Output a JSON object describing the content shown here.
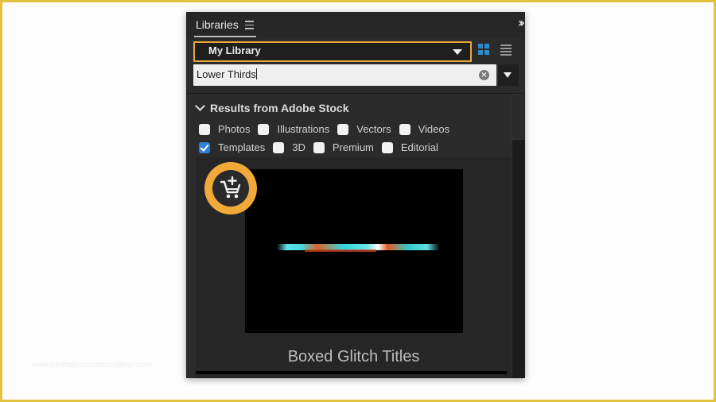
{
  "panel": {
    "tab_label": "Libraries",
    "tab_menu_icon": "hamburger-icon",
    "collapse_icon": "double-chevron-right-icon",
    "library_select": {
      "value": "My Library",
      "accent": "#e7a83a"
    },
    "view_modes": {
      "grid": "grid-view-icon",
      "list": "list-view-icon",
      "active": "grid",
      "active_color": "#2d8ac7"
    },
    "search": {
      "value": "Lower Thirds",
      "clear_icon": "clear-circle-icon",
      "options_icon": "caret-down-icon"
    }
  },
  "stock": {
    "section_title": "Results from Adobe Stock",
    "filters": [
      {
        "label": "Photos",
        "checked": false
      },
      {
        "label": "Illustrations",
        "checked": false
      },
      {
        "label": "Vectors",
        "checked": false
      },
      {
        "label": "Videos",
        "checked": false
      },
      {
        "label": "Templates",
        "checked": true
      },
      {
        "label": "3D",
        "checked": false
      },
      {
        "label": "Premium",
        "checked": false
      },
      {
        "label": "Editorial",
        "checked": false
      }
    ],
    "results": [
      {
        "title": "Boxed Glitch Titles",
        "action_icon": "cart-add-icon",
        "highlight_color": "#f1a93a"
      }
    ]
  },
  "watermark": "www.heritagechristiancollege.com",
  "frame_color": "#e3c23e"
}
